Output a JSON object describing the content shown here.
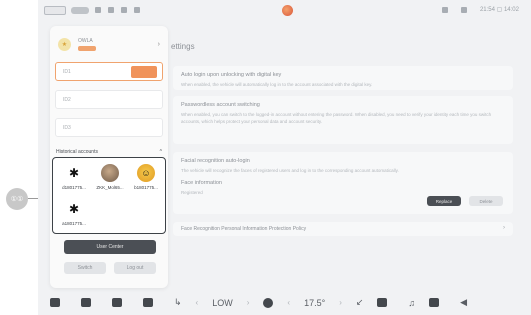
{
  "callout": {
    "label": "①①"
  },
  "status_bar": {
    "time": "21:54 ▢ 14:02"
  },
  "settings": {
    "title": "ettings",
    "cards": [
      {
        "title": "Auto login upon unlocking with digital key",
        "desc": "When enabled, the vehicle will automatically log in to the account associated with the digital key."
      },
      {
        "title": "Passwordless account switching",
        "desc": "When enabled, you can switch to the logged-in account without entering the password. When disabled, you need to verify your identity each time you switch accounts, which helps protect your personal data and account security."
      },
      {
        "title": "Facial recognition auto-login",
        "desc": "The vehicle will recognize the faces of registered users and log in to the corresponding account automatically."
      }
    ],
    "face_info": {
      "label": "Face information",
      "sub": "Registered",
      "primary": "Replace",
      "secondary": "Delete"
    },
    "policy": "Face Recognition Personal Information Protection Policy"
  },
  "panel": {
    "profile_name": "OWLA",
    "fields": [
      "ID1",
      "ID2",
      "ID3"
    ],
    "history_title": "Historical accounts",
    "history_toggle": "^",
    "accounts": [
      {
        "label": "d1801775...",
        "icon": "spider-icon"
      },
      {
        "label": "ZKK_Mol65...",
        "icon": "photo-avatar"
      },
      {
        "label": "b1801775...",
        "icon": "emoji-avatar"
      },
      {
        "label": "a1801775...",
        "icon": "spider-icon"
      }
    ],
    "user_center": "User Center",
    "switch": "Switch",
    "logout": "Log out"
  },
  "dock": {
    "fan_level": "LOW",
    "temperature": "17.5°"
  }
}
